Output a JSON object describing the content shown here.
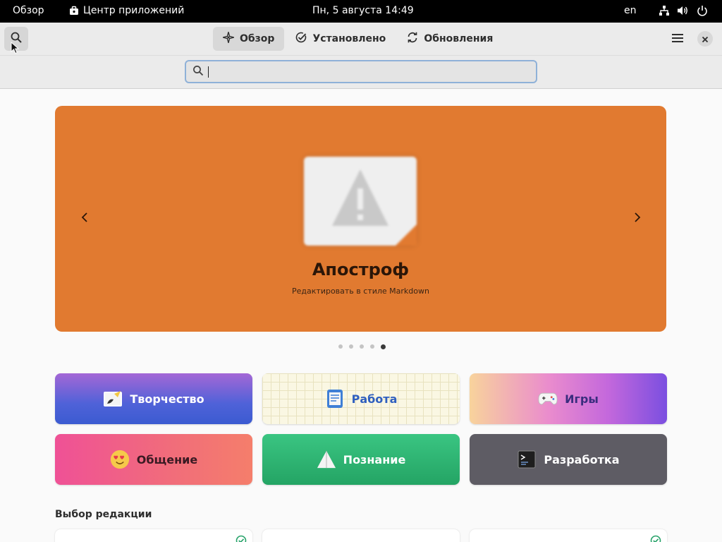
{
  "topbar": {
    "activities": "Обзор",
    "app_name": "Центр приложений",
    "clock": "Пн, 5 августа  14:49",
    "lang": "en"
  },
  "header": {
    "tabs": [
      {
        "label": "Обзор",
        "icon": "explore-icon",
        "active": true
      },
      {
        "label": "Установлено",
        "icon": "check-circle-icon",
        "active": false
      },
      {
        "label": "Обновления",
        "icon": "refresh-icon",
        "active": false
      }
    ]
  },
  "search": {
    "value": "",
    "placeholder": ""
  },
  "banner": {
    "title": "Апостроф",
    "subtitle": "Редактировать в стиле Markdown",
    "background": "#e17a30",
    "slides_total": 5,
    "slide_active": 5
  },
  "categories": [
    {
      "label": "Творчество",
      "icon": "create-icon"
    },
    {
      "label": "Работа",
      "icon": "work-icon"
    },
    {
      "label": "Игры",
      "icon": "gamepad-icon"
    },
    {
      "label": "Общение",
      "icon": "smiley-icon"
    },
    {
      "label": "Познание",
      "icon": "learn-icon"
    },
    {
      "label": "Разработка",
      "icon": "terminal-icon"
    }
  ],
  "editors_choice": {
    "title": "Выбор редакции"
  }
}
